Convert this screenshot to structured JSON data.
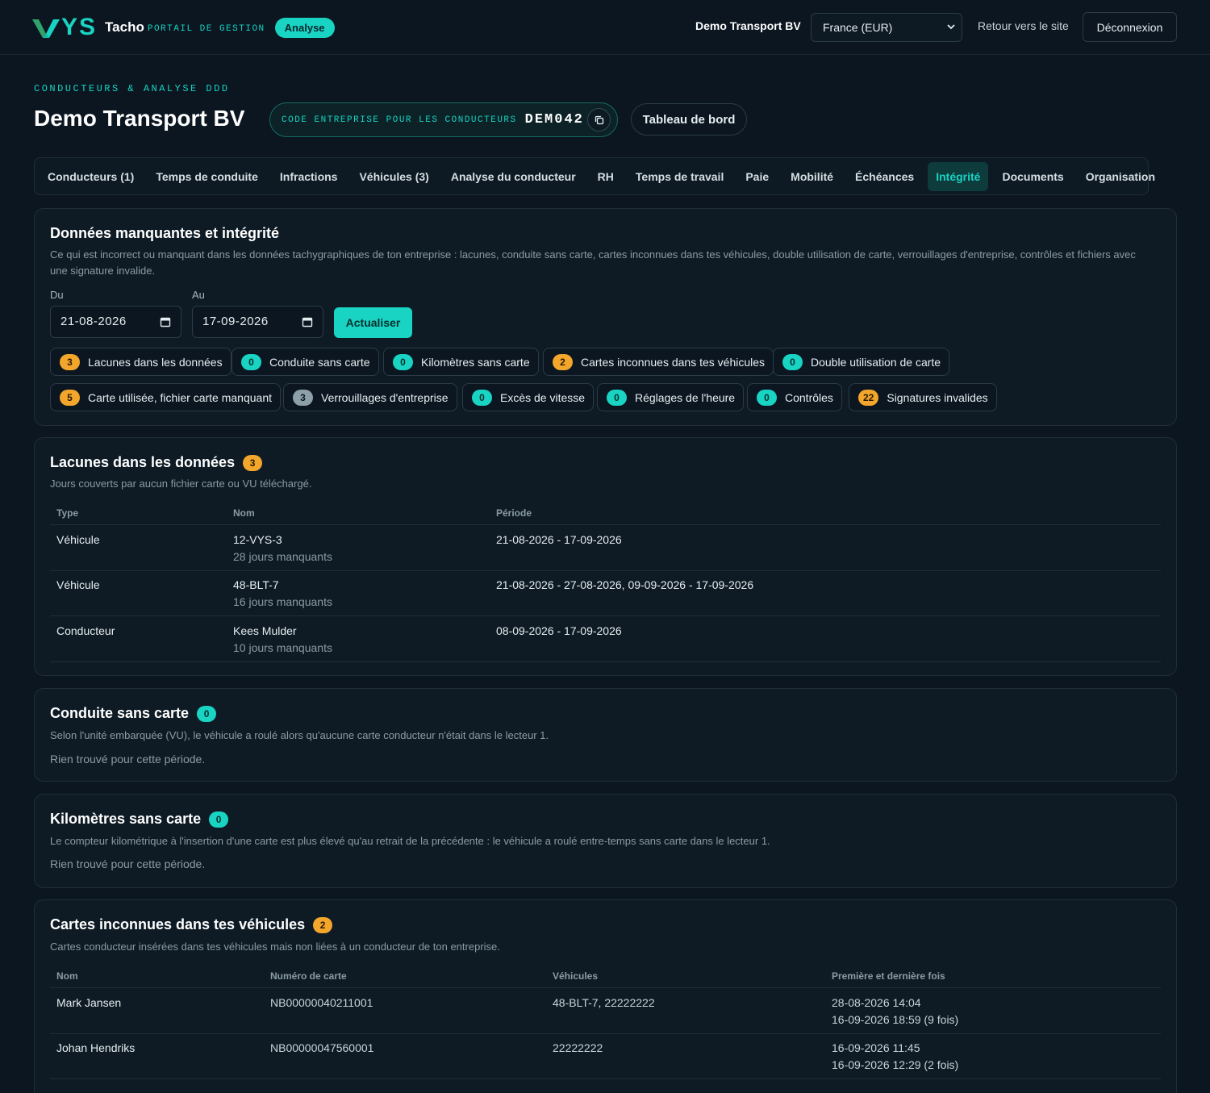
{
  "header": {
    "brand_ys": "YS",
    "brand_name": "Tacho",
    "brand_sub": "PORTAIL DE GESTION",
    "analyse_label": "Analyse",
    "company": "Demo Transport BV",
    "country_select": "France (EUR)",
    "back_link": "Retour vers le site",
    "logout": "Déconnexion"
  },
  "page": {
    "eyebrow": "CONDUCTEURS & ANALYSE DDD",
    "title": "Demo Transport BV",
    "code_label": "CODE ENTREPRISE POUR LES CONDUCTEURS",
    "code_value": "DEM042",
    "dashboard_btn": "Tableau de bord"
  },
  "tabs": [
    {
      "label": "Conducteurs (1)"
    },
    {
      "label": "Temps de conduite"
    },
    {
      "label": "Infractions"
    },
    {
      "label": "Véhicules (3)"
    },
    {
      "label": "Analyse du conducteur"
    },
    {
      "label": "RH"
    },
    {
      "label": "Temps de travail"
    },
    {
      "label": "Paie"
    },
    {
      "label": "Mobilité"
    },
    {
      "label": "Échéances"
    },
    {
      "label": "Intégrité",
      "active": true
    },
    {
      "label": "Documents"
    },
    {
      "label": "Organisation"
    }
  ],
  "integrity": {
    "title": "Données manquantes et intégrité",
    "description": "Ce qui est incorrect ou manquant dans les données tachygraphiques de ton entreprise : lacunes, conduite sans carte, cartes inconnues dans tes véhicules, double utilisation de carte, verrouillages d'entreprise, contrôles et fichiers avec une signature invalide.",
    "from_label": "Du",
    "from_value": "21-08-2026",
    "to_label": "Au",
    "to_value": "17-09-2026",
    "refresh": "Actualiser",
    "chips": [
      {
        "count": "3",
        "label": "Lacunes dans les données",
        "color": "orange"
      },
      {
        "count": "0",
        "label": "Conduite sans carte",
        "color": "teal"
      },
      {
        "count": "0",
        "label": "Kilomètres sans carte",
        "color": "teal"
      },
      {
        "count": "2",
        "label": "Cartes inconnues dans tes véhicules",
        "color": "orange"
      },
      {
        "count": "0",
        "label": "Double utilisation de carte",
        "color": "teal"
      },
      {
        "count": "5",
        "label": "Carte utilisée, fichier carte manquant",
        "color": "orange"
      },
      {
        "count": "3",
        "label": "Verrouillages d'entreprise",
        "color": "grey"
      },
      {
        "count": "0",
        "label": "Excès de vitesse",
        "color": "teal"
      },
      {
        "count": "0",
        "label": "Réglages de l'heure",
        "color": "teal"
      },
      {
        "count": "0",
        "label": "Contrôles",
        "color": "teal"
      },
      {
        "count": "22",
        "label": "Signatures invalides",
        "color": "orange"
      }
    ]
  },
  "gaps": {
    "title": "Lacunes dans les données",
    "count": "3",
    "description": "Jours couverts par aucun fichier carte ou VU téléchargé.",
    "columns": [
      "Type",
      "Nom",
      "Période"
    ],
    "rows": [
      {
        "type": "Véhicule",
        "name": "12-VYS-3",
        "sub": "28 jours manquants",
        "period": "21-08-2026 - 17-09-2026"
      },
      {
        "type": "Véhicule",
        "name": "48-BLT-7",
        "sub": "16 jours manquants",
        "period": "21-08-2026 - 27-08-2026, 09-09-2026 - 17-09-2026"
      },
      {
        "type": "Conducteur",
        "name": "Kees Mulder",
        "sub": "10 jours manquants",
        "period": "08-09-2026 - 17-09-2026"
      }
    ]
  },
  "no_card": {
    "title": "Conduite sans carte",
    "count": "0",
    "description": "Selon l'unité embarquée (VU), le véhicule a roulé alors qu'aucune carte conducteur n'était dans le lecteur 1.",
    "empty": "Rien trouvé pour cette période."
  },
  "km_no_card": {
    "title": "Kilomètres sans carte",
    "count": "0",
    "description": "Le compteur kilométrique à l'insertion d'une carte est plus élevé qu'au retrait de la précédente : le véhicule a roulé entre-temps sans carte dans le lecteur 1.",
    "empty": "Rien trouvé pour cette période."
  },
  "unknown_cards": {
    "title": "Cartes inconnues dans tes véhicules",
    "count": "2",
    "description": "Cartes conducteur insérées dans tes véhicules mais non liées à un conducteur de ton entreprise.",
    "columns": [
      "Nom",
      "Numéro de carte",
      "Véhicules",
      "Première et dernière fois"
    ],
    "rows": [
      {
        "name": "Mark Jansen",
        "card": "NB00000040211001",
        "vehicles": "48-BLT-7, 22222222",
        "first": "28-08-2026 14:04",
        "last": "16-09-2026 18:59 (9 fois)"
      },
      {
        "name": "Johan Hendriks",
        "card": "NB00000047560001",
        "vehicles": "22222222",
        "first": "16-09-2026 11:45",
        "last": "16-09-2026 12:29 (2 fois)"
      }
    ]
  },
  "colors": {
    "accent": "#19d3c3",
    "background": "#0b1620",
    "card": "#0e1b25",
    "warning": "#f2a62b"
  }
}
